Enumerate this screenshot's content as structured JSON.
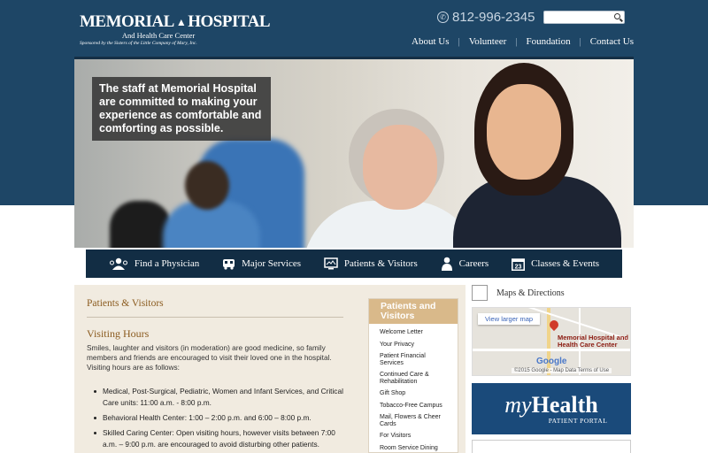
{
  "header": {
    "logo_main_left": "MEMORIAL",
    "logo_main_right": "HOSPITAL",
    "logo_sub": "And Health Care Center",
    "logo_sponsor": "Sponsored by the Sisters of the Little Company of Mary, Inc.",
    "phone": "812-996-2345",
    "search_placeholder": "",
    "links": [
      "About Us",
      "Volunteer",
      "Foundation",
      "Contact Us"
    ]
  },
  "hero": {
    "caption": "The staff at Memorial Hospital are committed to making your experience as comfortable and comforting as possible."
  },
  "main_nav": [
    {
      "label": "Find a Physician",
      "icon": "physician-icon"
    },
    {
      "label": "Major Services",
      "icon": "ambulance-icon"
    },
    {
      "label": "Patients & Visitors",
      "icon": "monitor-icon"
    },
    {
      "label": "Careers",
      "icon": "person-icon"
    },
    {
      "label": "Classes & Events",
      "icon": "calendar-icon",
      "icon_text": "23"
    }
  ],
  "content": {
    "breadcrumb": "Patients & Visitors",
    "section_title": "Visiting Hours",
    "intro": "Smiles, laughter and visitors (in moderation) are good medicine, so family members and friends are encouraged to visit their loved one in the hospital. Visiting hours are as follows:",
    "bullets": [
      "Medical, Post-Surgical, Pediatric, Women and Infant Services, and Critical Care units: 11:00 a.m. - 8:00 p.m.",
      "Behavioral Health Center: 1:00 – 2:00 p.m. and 6:00 – 8:00 p.m.",
      "Skilled Caring Center: Open visiting hours, however visits between 7:00 a.m. – 9:00 p.m. are encouraged to avoid disturbing other patients."
    ]
  },
  "side_menu": {
    "title": "Patients and Visitors",
    "items": [
      "Welcome Letter",
      "Your Privacy",
      "Patient Financial Services",
      "Continued Care & Rehabilitation",
      "Gift Shop",
      "Tobacco-Free Campus",
      "Mail, Flowers & Cheer Cards",
      "For Visitors",
      "Room Service Dining"
    ]
  },
  "maps": {
    "label": "Maps & Directions",
    "view_larger": "View larger map",
    "place": "Memorial Hospital and Health Care Center",
    "google": "Google",
    "attribution": "©2015 Google - Map Data    Terms of Use"
  },
  "myhealth": {
    "my": "my",
    "health": "Health",
    "portal": "PATIENT PORTAL"
  },
  "colors": {
    "header_bg": "#1e4666",
    "nav_bg": "#122d44",
    "accent_brown": "#8a5a1e",
    "side_header": "#d9b98a",
    "content_bg": "#f1ebe0"
  }
}
